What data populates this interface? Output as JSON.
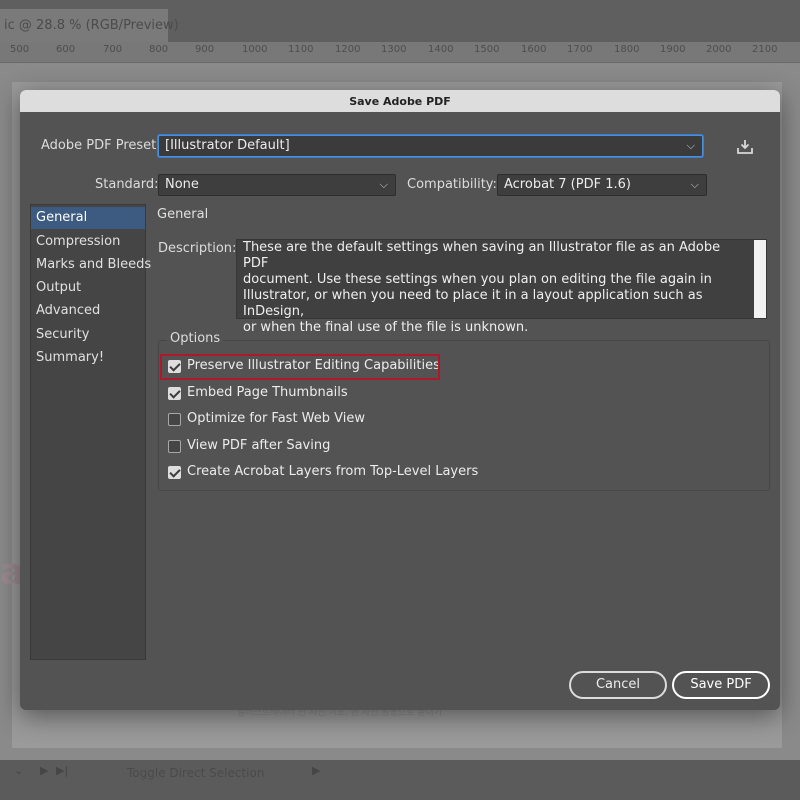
{
  "background": {
    "doc_tab_title": "ic @ 28.8 % (RGB/Preview)",
    "ruler_ticks": [
      "500",
      "600",
      "700",
      "800",
      "900",
      "1000",
      "1100",
      "1200",
      "1300",
      "1400",
      "1500",
      "1600",
      "1700",
      "1800",
      "1900",
      "2000",
      "2100"
    ],
    "bottom_tool_label": "Toggle Direct Selection",
    "faded_korean_text": "일러스트레이터 안 사진 기초, 한 사진 활용으로 끝내기"
  },
  "dialog": {
    "title": "Save Adobe PDF",
    "preset_label": "Adobe PDF Preset:",
    "preset_value": "[Illustrator Default]",
    "standard_label": "Standard:",
    "standard_value": "None",
    "compat_label": "Compatibility:",
    "compat_value": "Acrobat 7 (PDF 1.6)",
    "sidebar": {
      "items": [
        {
          "label": "General",
          "active": true
        },
        {
          "label": "Compression",
          "active": false
        },
        {
          "label": "Marks and Bleeds",
          "active": false
        },
        {
          "label": "Output",
          "active": false
        },
        {
          "label": "Advanced",
          "active": false
        },
        {
          "label": "Security",
          "active": false
        },
        {
          "label": "Summary!",
          "active": false
        }
      ]
    },
    "section_title": "General",
    "description_label": "Description:",
    "description_lines": [
      "These are the default settings when saving an Illustrator file as an Adobe PDF",
      "document. Use these settings when you plan on editing the file again in",
      "Illustrator, or when you need to place it in a layout application such as InDesign,",
      "or when the final use of the file is unknown."
    ],
    "options_title": "Options",
    "options": [
      {
        "label": "Preserve Illustrator Editing Capabilities",
        "checked": true
      },
      {
        "label": "Embed Page Thumbnails",
        "checked": true
      },
      {
        "label": "Optimize for Fast Web View",
        "checked": false
      },
      {
        "label": "View PDF after Saving",
        "checked": false
      },
      {
        "label": "Create Acrobat Layers from Top-Level Layers",
        "checked": true
      }
    ],
    "cancel_label": "Cancel",
    "save_label": "Save PDF"
  },
  "colors": {
    "dialog_bg": "#535353",
    "active_item": "#3d5a80",
    "focus_ring": "#4a8fd8",
    "highlight_box": "#b0182a"
  }
}
